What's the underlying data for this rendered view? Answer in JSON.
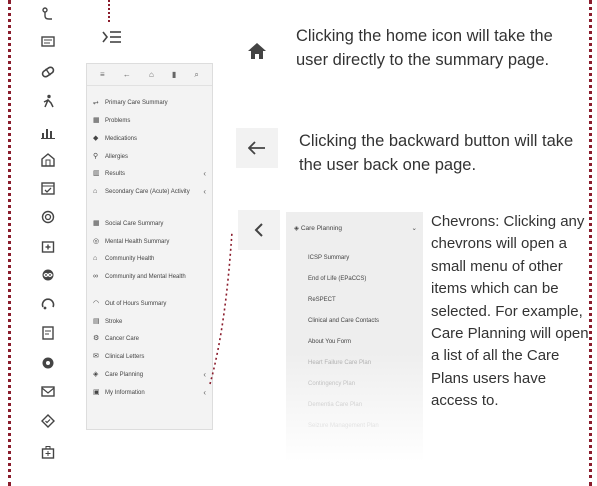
{
  "colors": {
    "accent_dots": "#8a1c2c",
    "panel_bg": "#f3f3f3"
  },
  "rail": {
    "icons": [
      "route-icon",
      "message-icon",
      "pill-icon",
      "person-allergy-icon",
      "bar-chart-icon",
      "hospital-icon",
      "calendar-icon",
      "fingerprint-icon",
      "medical-bag-icon",
      "infinity-icon",
      "cycle-icon",
      "document-icon",
      "settings-icon",
      "envelope-icon",
      "diamond-icon",
      "bag-icon"
    ]
  },
  "panel": {
    "items": [
      {
        "label": "Primary Care Summary",
        "icon": "route-icon"
      },
      {
        "label": "Problems",
        "icon": "grid-icon"
      },
      {
        "label": "Medications",
        "icon": "pill-icon"
      },
      {
        "label": "Allergies",
        "icon": "person-allergy-icon"
      },
      {
        "label": "Results",
        "icon": "bar-chart-icon",
        "chevron": true
      },
      {
        "label": "Secondary Care (Acute) Activity",
        "icon": "hospital-icon",
        "chevron": true
      },
      {
        "label": "Social Care Summary",
        "icon": "building-icon"
      },
      {
        "label": "Mental Health Summary",
        "icon": "brain-icon"
      },
      {
        "label": "Community Health",
        "icon": "house-icon"
      },
      {
        "label": "Community and Mental Health",
        "icon": "infinity-icon"
      },
      {
        "label": "Out of Hours Summary",
        "icon": "cycle-icon"
      },
      {
        "label": "Stroke",
        "icon": "document-icon"
      },
      {
        "label": "Cancer Care",
        "icon": "settings-icon"
      },
      {
        "label": "Clinical Letters",
        "icon": "envelope-icon"
      },
      {
        "label": "Care Planning",
        "icon": "diamond-icon",
        "chevron": true
      },
      {
        "label": "My Information",
        "icon": "bag-icon",
        "chevron": true
      }
    ]
  },
  "home_text": "Clicking the home icon will take the user directly to the summary page.",
  "back_text": "Clicking the backward button will take the user back one page.",
  "chevron_text": "Chevrons: Clicking any chevrons will open a small menu of other items which can be selected. For example, Care Planning will open a list of all the Care Plans users have access to.",
  "submenu": {
    "title": "Care Planning",
    "items": [
      "ICSP Summary",
      "End of Life (EPaCCS)",
      "ReSPECT",
      "Clinical and Care Contacts",
      "About You Form",
      "Heart Failure Care Plan",
      "Contingency Plan",
      "Dementia Care Plan",
      "Seizure Management Plan"
    ]
  }
}
